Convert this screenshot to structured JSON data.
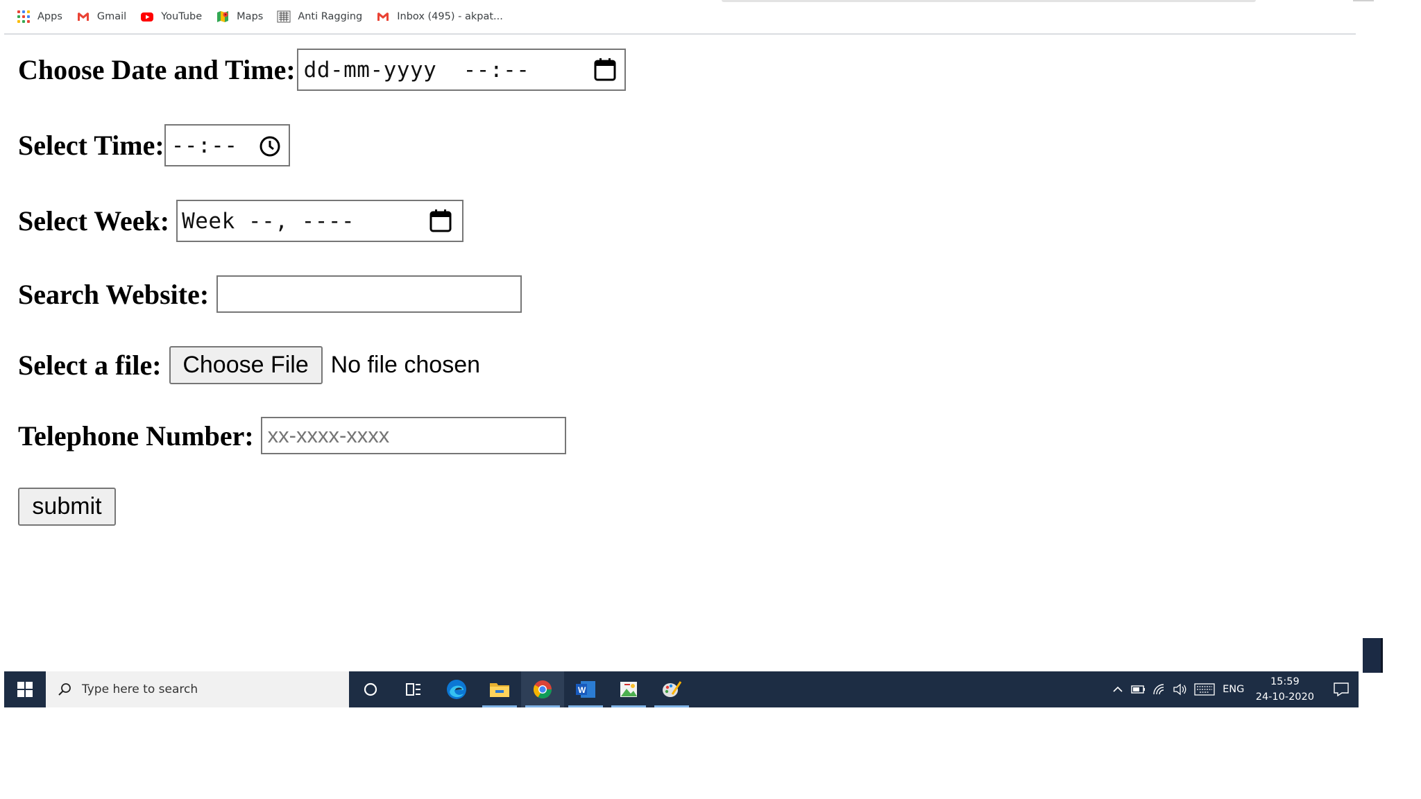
{
  "bookmarks": [
    {
      "label": "Apps",
      "icon": "apps-grid-icon"
    },
    {
      "label": "Gmail",
      "icon": "gmail-icon"
    },
    {
      "label": "YouTube",
      "icon": "youtube-icon"
    },
    {
      "label": "Maps",
      "icon": "maps-icon"
    },
    {
      "label": "Anti Ragging",
      "icon": "anti-ragging-icon"
    },
    {
      "label": "Inbox (495) - akpat...",
      "icon": "gmail-icon"
    }
  ],
  "form": {
    "datetime": {
      "label": "Choose Date and Time:",
      "placeholder": "dd-mm-yyyy  --:--"
    },
    "time": {
      "label": "Select Time:",
      "placeholder": "--:--"
    },
    "week": {
      "label": "Select Week:",
      "placeholder": "Week --, ----"
    },
    "search": {
      "label": "Search Website:",
      "value": ""
    },
    "file": {
      "label": "Select a file:",
      "button": "Choose File",
      "status": "No file chosen"
    },
    "tel": {
      "label": "Telephone Number:",
      "placeholder": "xx-xxxx-xxxx"
    },
    "submit": "submit"
  },
  "taskbar": {
    "search_placeholder": "Type here to search",
    "apps": [
      "cortana-circle-icon",
      "task-view-icon",
      "edge-icon",
      "file-explorer-icon",
      "chrome-icon",
      "word-icon",
      "photos-icon",
      "paint-icon"
    ],
    "active_app": "chrome-icon",
    "language": "ENG",
    "time": "15:59",
    "date": "24-10-2020"
  },
  "colors": {
    "taskbar_bg": "#1d2d44",
    "search_bg": "#f1f1f1",
    "input_border": "#767676",
    "button_bg": "#efefef",
    "placeholder": "#757575"
  }
}
